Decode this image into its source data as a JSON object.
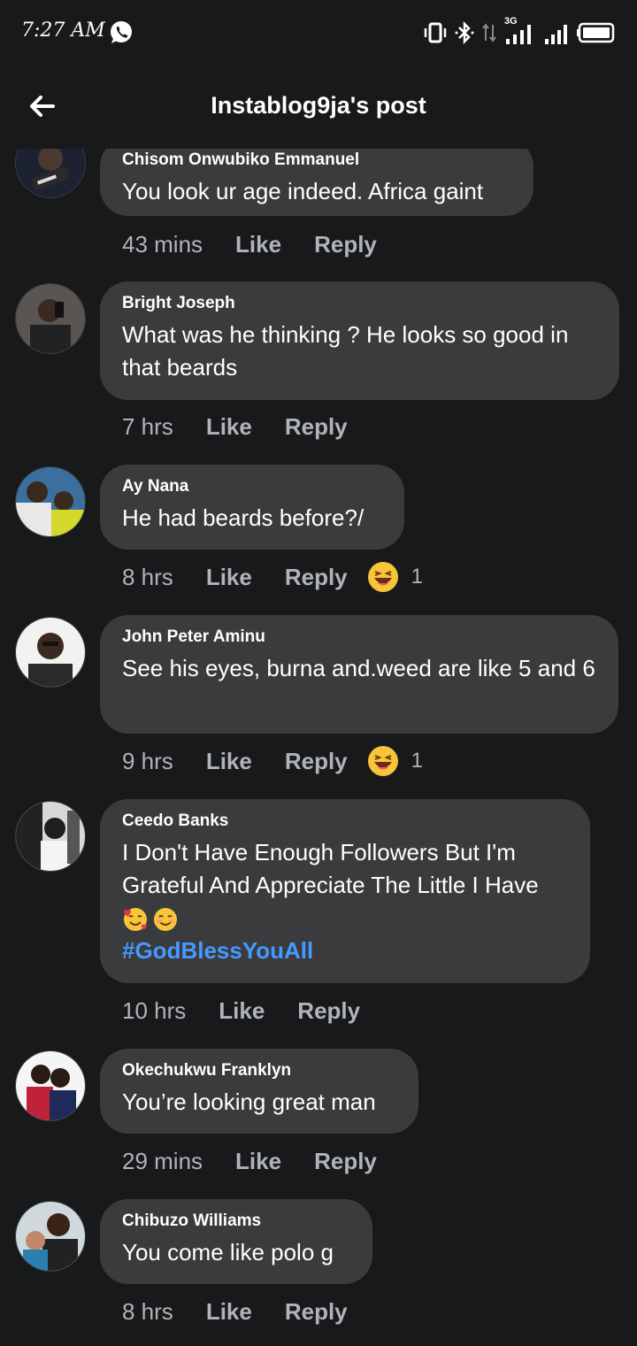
{
  "status_bar": {
    "time": "7:27 AM",
    "network": "3G",
    "icons": [
      "vibrate-icon",
      "bluetooth-icon",
      "data-arrows-icon",
      "signal-icon",
      "battery-icon"
    ]
  },
  "header": {
    "title": "Instablog9ja's post",
    "back_icon": "back-arrow-icon"
  },
  "colors": {
    "background": "#18191a",
    "bubble": "#3a3b3c",
    "text": "#ffffff",
    "muted": "#b0b3b8",
    "hashtag": "#4599ff"
  },
  "comments": [
    {
      "author": "Chisom Onwubiko Emmanuel",
      "text": "You look ur age indeed. Africa gaint",
      "time": "43 mins",
      "like": "Like",
      "reply": "Reply"
    },
    {
      "author": "Bright Joseph",
      "text": "What was he thinking ? He looks so good in that beards",
      "time": "7 hrs",
      "like": "Like",
      "reply": "Reply"
    },
    {
      "author": "Ay Nana",
      "text": "He had beards before?/",
      "time": "8 hrs",
      "like": "Like",
      "reply": "Reply",
      "reaction": {
        "icon": "haha-reaction-icon",
        "count": "1"
      }
    },
    {
      "author": "John Peter Aminu",
      "text": "See his eyes, burna and.weed are like 5 and 6",
      "time": "9 hrs",
      "like": "Like",
      "reply": "Reply",
      "reaction": {
        "icon": "haha-reaction-icon",
        "count": "1"
      }
    },
    {
      "author": "Ceedo Banks",
      "text": "I Don't Have Enough Followers But I'm Grateful And Appreciate The Little I Have",
      "emojis": [
        "smiling-face-with-hearts-icon",
        "smiling-face-icon"
      ],
      "hashtag": "#GodBlessYouAll",
      "time": "10 hrs",
      "like": "Like",
      "reply": "Reply"
    },
    {
      "author": "Okechukwu Franklyn",
      "text": "You’re looking great man",
      "time": "29 mins",
      "like": "Like",
      "reply": "Reply"
    },
    {
      "author": "Chibuzo Williams",
      "text": "You come like polo g",
      "time": "8 hrs",
      "like": "Like",
      "reply": "Reply"
    }
  ]
}
